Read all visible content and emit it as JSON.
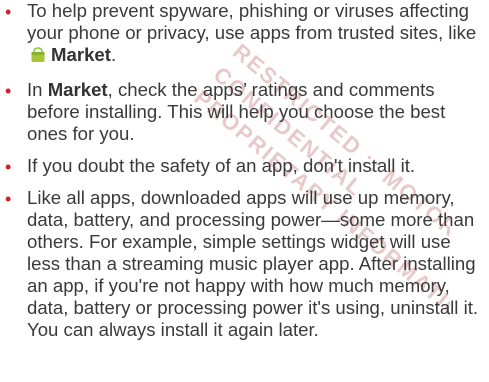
{
  "tips": [
    {
      "before": "To help prevent spyware, phishing or viruses affecting your phone or privacy, use apps from trusted sites, like",
      "bold": "Market",
      "after": "."
    },
    {
      "before": "In",
      "bold": "Market",
      "after": ", check the apps’ ratings and comments before installing. This will help you choose the best ones for you."
    },
    {
      "text": "If you doubt the safety of an app, don't install it."
    },
    {
      "text": "Like all apps, downloaded apps will use up memory, data, battery, and processing power—some more than others. For example, simple settings widget will use less than a streaming music player app. After installing an app, if you're not happy with how much memory, data, battery or processing power it's using, uninstall it. You can always install it again later."
    }
  ],
  "bullet_glyph": "•",
  "icons": {
    "market": "market-icon"
  },
  "colors": {
    "bullet": "#d62027",
    "text": "#3a3a3a",
    "watermark": "#e8c9c9"
  }
}
